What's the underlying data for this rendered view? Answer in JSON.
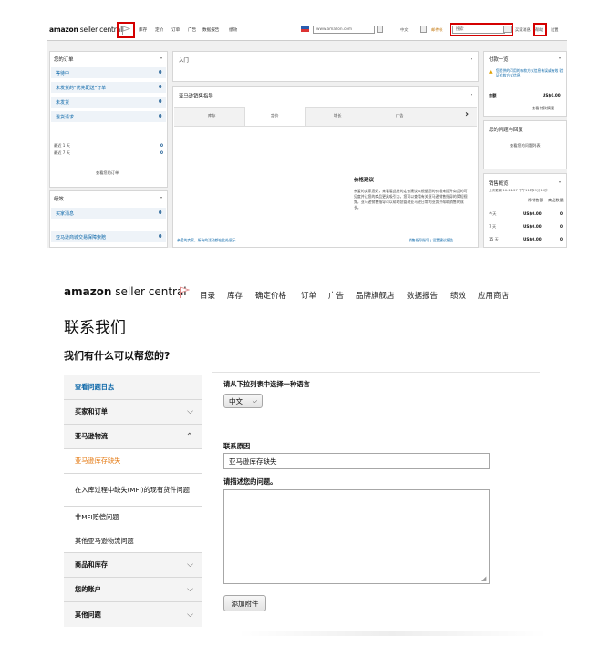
{
  "top": {
    "logo_main": "amazon",
    "logo_sub": " seller central",
    "nav": [
      "库存",
      "定价",
      "订单",
      "广告",
      "数据报告",
      "绩效"
    ],
    "url_field": "www.amazon.com",
    "lang_value": "中文",
    "mail_text": "邮件帐",
    "search_placeholder": "搜索",
    "buyer_messages": "买家消息",
    "help": "帮助",
    "settings": "设置",
    "orders_panel": {
      "title": "您的订单",
      "rows": [
        {
          "label": "等待中",
          "count": "0"
        },
        {
          "label": "未发货的“优先配送”订单",
          "count": "0"
        },
        {
          "label": "未发货",
          "count": "0"
        },
        {
          "label": "退货请求",
          "count": "0"
        }
      ],
      "recent": [
        {
          "label": "最近 1 天",
          "count": "0"
        },
        {
          "label": "最近 7 天",
          "count": "0"
        }
      ],
      "view_link": "查看您的订单"
    },
    "perf_panel": {
      "title": "绩效",
      "rows": [
        {
          "label": "买家消息",
          "count": "0"
        },
        {
          "label": "亚马逊商城交易保障索赔",
          "count": "0"
        }
      ]
    },
    "entry_panel": {
      "title": "入门"
    },
    "guide_panel": {
      "title": "亚马逊销售指导",
      "tabs": [
        "库存",
        "定价",
        "增长",
        "广告"
      ],
      "next": "›",
      "pricing_title": "价格建议",
      "pricing_text": "亲爱的卖家您好，来看看此处的定价建议以根据您的价格来提升商品的可见度并让您的商品更具吸引力。您可以查看有关亚马逊销售指导的简短视频，亚马逊销售指导可以帮助您管理亚马逊日常的业务并帮助销售的成长。",
      "footer_left": "亲爱的卖家，所有的活动都在此处展示",
      "footer_right": "销售指导指导 | 设置建议报告"
    },
    "payments_panel": {
      "title": "付款一览",
      "warning": "您提供的可用的存款方式信息有误或有效 验证存款方式信息",
      "balance_label": "余额",
      "balance_value": "US$0.00",
      "summary_link": "查看付款摘要"
    },
    "issues_panel": {
      "title": "您的问题与回复",
      "link": "查看您的问题列表"
    },
    "sales_panel": {
      "title": "销售概览",
      "updated": "上次更新 16-12-27 下午11时29分10秒",
      "col_sales": "净销售额",
      "col_units": "商品数量",
      "rows": [
        {
          "period": "今天",
          "sales": "US$0.00",
          "units": "0"
        },
        {
          "period": "7 天",
          "sales": "US$0.00",
          "units": "0"
        },
        {
          "period": "15 天",
          "sales": "US$0.00",
          "units": "0"
        }
      ]
    }
  },
  "bottom": {
    "logo_main": "amazon",
    "logo_sub": " seller central",
    "nav": [
      "目录",
      "库存",
      "确定价格",
      "订单",
      "广告",
      "品牌旗舰店",
      "数据报告",
      "绩效",
      "应用商店"
    ],
    "page_title": "联系我们",
    "subtitle": "我们有什么可以帮您的?",
    "sidebar": [
      {
        "label": "查看问题日志",
        "type": "link"
      },
      {
        "label": "买家和订单",
        "type": "section",
        "chevron": "down"
      },
      {
        "label": "亚马逊物流",
        "type": "section",
        "chevron": "up"
      },
      {
        "label": "亚马逊库存缺失",
        "type": "active"
      },
      {
        "label": "在入库过程中缺失(MFI)的现有货件问题",
        "type": "plain"
      },
      {
        "label": "非MFI赔偿问题",
        "type": "plain"
      },
      {
        "label": "其他亚马逊物流问题",
        "type": "plain"
      },
      {
        "label": "商品和库存",
        "type": "section",
        "chevron": "down"
      },
      {
        "label": "您的账户",
        "type": "section",
        "chevron": "down"
      },
      {
        "label": "其他问题",
        "type": "section",
        "chevron": "down"
      }
    ],
    "form": {
      "lang_prompt": "请从下拉列表中选择一种语言",
      "lang_value": "中文",
      "reason_label": "联系原因",
      "reason_value": "亚马逊库存缺失",
      "desc_label": "请描述您的问题。",
      "attach_button": "添加附件"
    }
  }
}
